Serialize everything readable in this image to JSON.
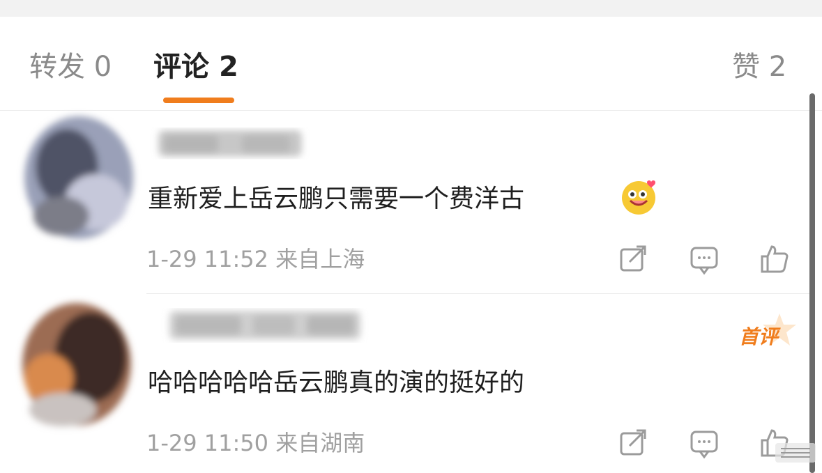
{
  "tabs": {
    "repost": {
      "label": "转发",
      "count": "0"
    },
    "comments": {
      "label": "评论",
      "count": "2"
    },
    "likes": {
      "label": "赞",
      "count": "2"
    }
  },
  "comments": [
    {
      "text": "重新爱上岳云鹏只需要一个费洋古",
      "emoji": "smiling-hearts-emoji",
      "date": "1-29",
      "time": "11:52",
      "location": "来自上海",
      "badge": ""
    },
    {
      "text": "哈哈哈哈哈岳云鹏真的演的挺好的",
      "date": "1-29",
      "time": "11:50",
      "location": "来自湖南",
      "badge": "首评"
    }
  ],
  "colors": {
    "accent": "#f07d1d",
    "muted_text": "#a0a0a0",
    "divider": "#ececec"
  },
  "icons": [
    "share-icon",
    "reply-icon",
    "like-icon"
  ]
}
